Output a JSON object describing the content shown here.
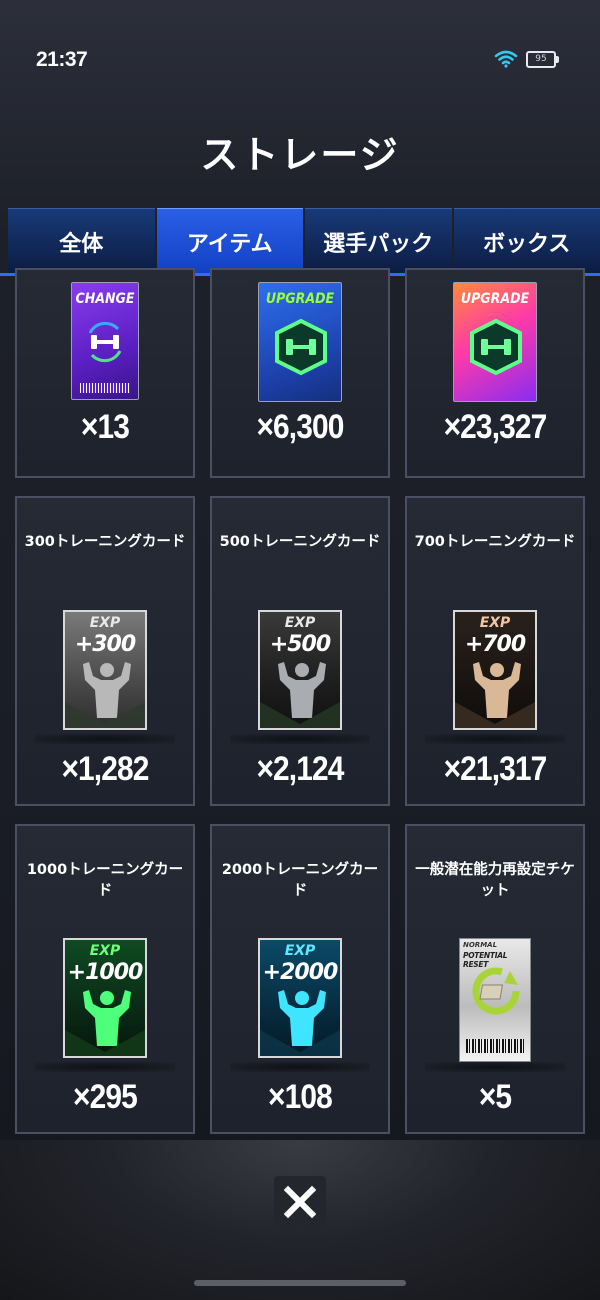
{
  "status_bar": {
    "time": "21:37",
    "battery": "95"
  },
  "title": "ストレージ",
  "tabs": [
    {
      "label": "全体",
      "active": false
    },
    {
      "label": "アイテム",
      "active": true
    },
    {
      "label": "選手パック",
      "active": false
    },
    {
      "label": "ボックス",
      "active": false
    }
  ],
  "items": [
    {
      "name": "",
      "icon": "change-ticket-icon",
      "badge": "CHANGE",
      "count": "×13"
    },
    {
      "name": "",
      "icon": "upgrade-ticket-blue-icon",
      "badge": "UPGRADE",
      "count": "×6,300"
    },
    {
      "name": "",
      "icon": "upgrade-ticket-pink-icon",
      "badge": "UPGRADE",
      "count": "×23,327"
    },
    {
      "name": "300トレーニングカード",
      "exp_label": "EXP",
      "exp_value": "+300",
      "count": "×1,282"
    },
    {
      "name": "500トレーニングカード",
      "exp_label": "EXP",
      "exp_value": "+500",
      "count": "×2,124"
    },
    {
      "name": "700トレーニングカード",
      "exp_label": "EXP",
      "exp_value": "+700",
      "count": "×21,317"
    },
    {
      "name": "1000トレーニングカード",
      "exp_label": "EXP",
      "exp_value": "+1000",
      "count": "×295"
    },
    {
      "name": "2000トレーニングカード",
      "exp_label": "EXP",
      "exp_value": "+2000",
      "count": "×108"
    },
    {
      "name": "一般潜在能力再設定チケット",
      "ticket_line1": "NORMAL",
      "ticket_line2": "POTENTIAL RESET",
      "count": "×5"
    }
  ],
  "colors": {
    "tab_active": "#1f4fd8",
    "tab_inactive": "#0f2654",
    "exp300": "#8e8e8e",
    "exp500": "#2b2b2b",
    "exp700": "#4a3a30",
    "exp1000": "#0f5a24",
    "exp2000": "#0c4e6a"
  }
}
